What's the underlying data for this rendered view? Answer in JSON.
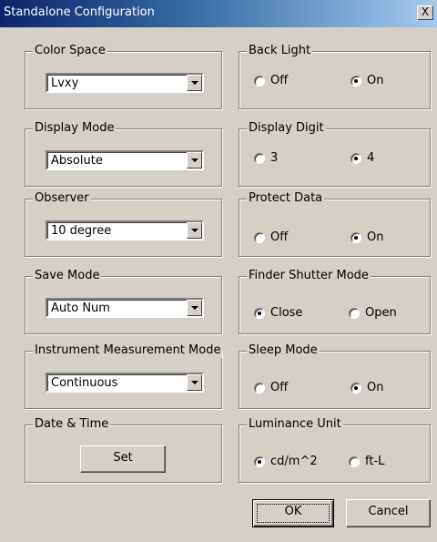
{
  "dialog": {
    "title": "Standalone Configuration",
    "close_glyph": "X"
  },
  "left_groups": [
    {
      "label": "Color Space",
      "value": "Lvxy"
    },
    {
      "label": "Display Mode",
      "value": "Absolute"
    },
    {
      "label": "Observer",
      "value": "10 degree"
    },
    {
      "label": "Save Mode",
      "value": "Auto Num"
    },
    {
      "label": "Instrument Measurement Mode",
      "value": "Continuous"
    }
  ],
  "date_time": {
    "label": "Date & Time",
    "button": "Set"
  },
  "right_groups": [
    {
      "label": "Back Light",
      "options": [
        {
          "label": "Off",
          "selected": false
        },
        {
          "label": "On",
          "selected": true
        }
      ]
    },
    {
      "label": "Display Digit",
      "options": [
        {
          "label": "3",
          "selected": false
        },
        {
          "label": "4",
          "selected": true
        }
      ]
    },
    {
      "label": "Protect Data",
      "options": [
        {
          "label": "Off",
          "selected": false
        },
        {
          "label": "On",
          "selected": true
        }
      ]
    },
    {
      "label": "Finder Shutter Mode",
      "options": [
        {
          "label": "Close",
          "selected": true
        },
        {
          "label": "Open",
          "selected": false
        }
      ]
    },
    {
      "label": "Sleep Mode",
      "options": [
        {
          "label": "Off",
          "selected": false
        },
        {
          "label": "On",
          "selected": true
        }
      ]
    },
    {
      "label": "Luminance Unit",
      "options": [
        {
          "label": "cd/m^2",
          "selected": true
        },
        {
          "label": "ft-L",
          "selected": false
        }
      ]
    }
  ],
  "buttons": {
    "ok": "OK",
    "cancel": "Cancel"
  },
  "colors": {
    "face": "#d4d0c8",
    "title_start": "#0a246a",
    "title_end": "#a6caf0"
  }
}
